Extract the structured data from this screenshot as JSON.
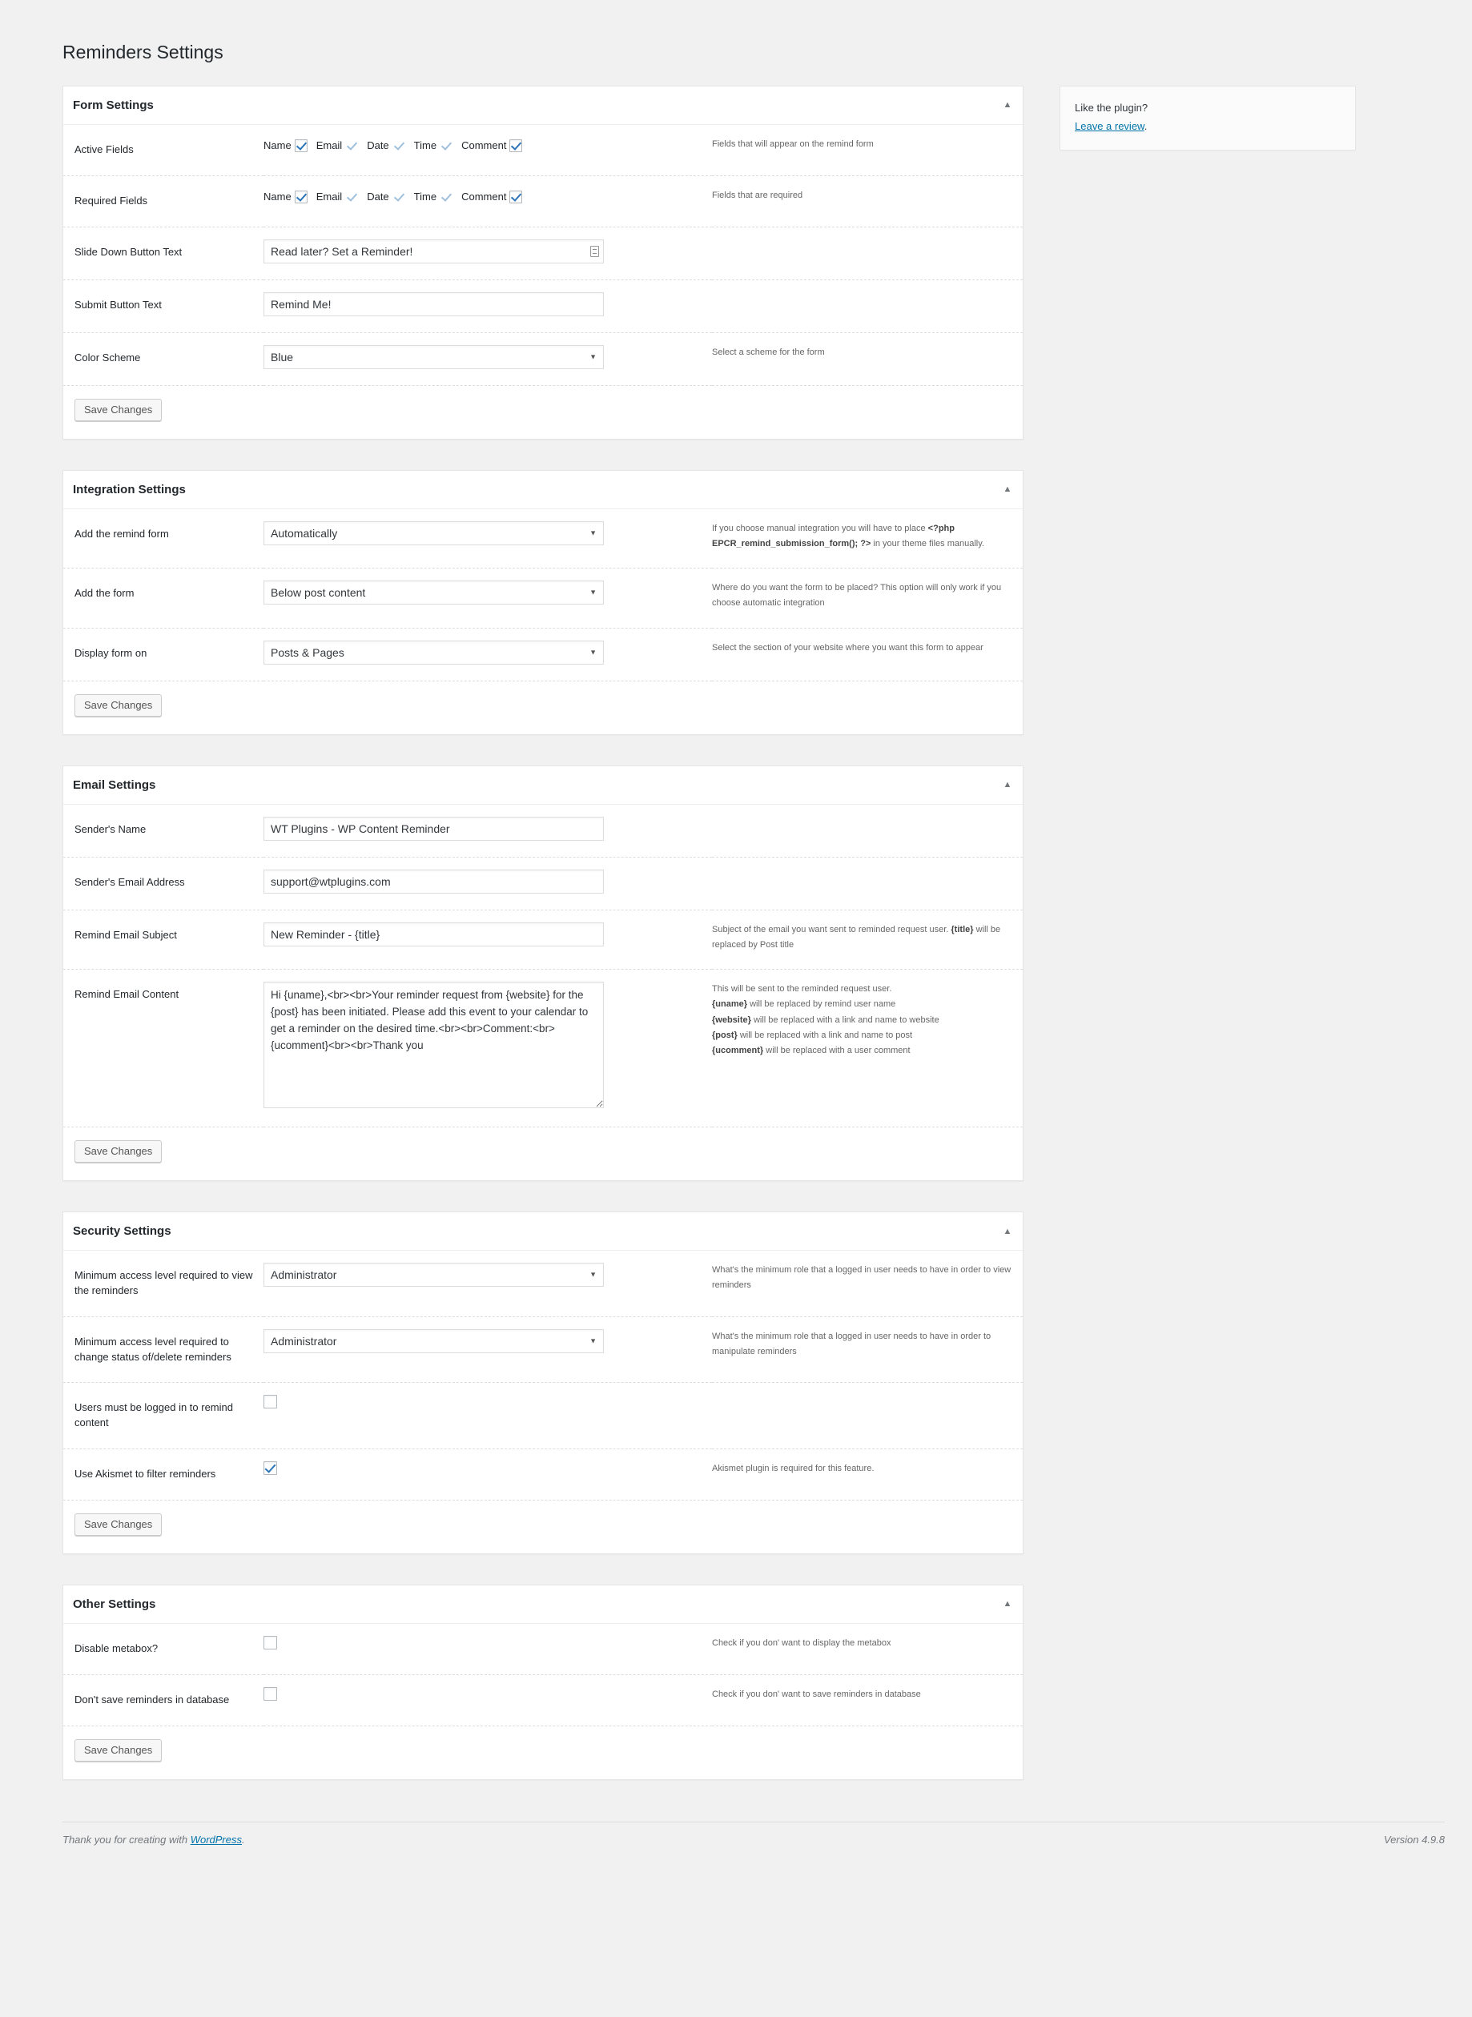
{
  "page": {
    "title": "Reminders Settings"
  },
  "sidebar": {
    "like_text": "Like the plugin?",
    "review_link": "Leave a review",
    "review_suffix": "."
  },
  "checkbox_fields": {
    "name": "Name",
    "email": "Email",
    "date": "Date",
    "time": "Time",
    "comment": "Comment"
  },
  "sections": {
    "form": {
      "title": "Form Settings",
      "toggle_icon": "chevron-up-icon",
      "rows": {
        "active_fields": {
          "label": "Active Fields",
          "desc": "Fields that will appear on the remind form"
        },
        "required_fields": {
          "label": "Required Fields",
          "desc": "Fields that are required"
        },
        "slide_down": {
          "label": "Slide Down Button Text",
          "value": "Read later? Set a Reminder!",
          "desc": ""
        },
        "submit_text": {
          "label": "Submit Button Text",
          "value": "Remind Me!",
          "desc": ""
        },
        "color_scheme": {
          "label": "Color Scheme",
          "value": "Blue",
          "desc": "Select a scheme for the form"
        }
      },
      "save_label": "Save Changes"
    },
    "integration": {
      "title": "Integration Settings",
      "toggle_icon": "chevron-up-icon",
      "rows": {
        "add_remind_form": {
          "label": "Add the remind form",
          "value": "Automatically",
          "desc_pre": "If you choose manual integration you will have to place ",
          "desc_code": "<?php EPCR_remind_submission_form(); ?>",
          "desc_post": " in your theme files manually."
        },
        "add_the_form": {
          "label": "Add the form",
          "value": "Below post content",
          "desc": "Where do you want the form to be placed? This option will only work if you choose automatic integration"
        },
        "display_form_on": {
          "label": "Display form on",
          "value": "Posts & Pages",
          "desc": "Select the section of your website where you want this form to appear"
        }
      },
      "save_label": "Save Changes"
    },
    "email": {
      "title": "Email Settings",
      "toggle_icon": "chevron-up-icon",
      "rows": {
        "sender_name": {
          "label": "Sender's Name",
          "value": "WT Plugins - WP Content Reminder",
          "desc": ""
        },
        "sender_email": {
          "label": "Sender's Email Address",
          "value": "support@wtplugins.com",
          "desc": ""
        },
        "subject": {
          "label": "Remind Email Subject",
          "value": "New Reminder - {title}",
          "desc_pre": "Subject of the email you want sent to reminded request user. ",
          "desc_code": "{title}",
          "desc_post": " will be replaced by Post title"
        },
        "content": {
          "label": "Remind Email Content",
          "value": "Hi {uname},<br><br>Your reminder request from {website} for the {post} has been initiated. Please add this event to your calendar to get a reminder on the desired time.<br><br>Comment:<br>{ucomment}<br><br>Thank you",
          "desc_intro": "This will be sent to the reminded request user.",
          "desc_tokens": [
            {
              "token": "{uname}",
              "text": " will be replaced by remind user name"
            },
            {
              "token": "{website}",
              "text": " will be replaced with a link and name to website"
            },
            {
              "token": "{post}",
              "text": " will be replaced with a link and name to post"
            },
            {
              "token": "{ucomment}",
              "text": " will be replaced with a user comment"
            }
          ]
        }
      },
      "save_label": "Save Changes"
    },
    "security": {
      "title": "Security Settings",
      "toggle_icon": "chevron-up-icon",
      "rows": {
        "view_level": {
          "label": "Minimum access level required to view the reminders",
          "value": "Administrator",
          "desc": "What's the minimum role that a logged in user needs to have in order to view reminders"
        },
        "change_level": {
          "label": "Minimum access level required to change status of/delete reminders",
          "value": "Administrator",
          "desc": "What's the minimum role that a logged in user needs to have in order to manipulate reminders"
        },
        "must_login": {
          "label": "Users must be logged in to remind content",
          "checked": false,
          "desc": ""
        },
        "akismet": {
          "label": "Use Akismet to filter reminders",
          "checked": true,
          "desc": "Akismet plugin is required for this feature."
        }
      },
      "save_label": "Save Changes"
    },
    "other": {
      "title": "Other Settings",
      "toggle_icon": "chevron-up-icon",
      "rows": {
        "disable_metabox": {
          "label": "Disable metabox?",
          "checked": false,
          "desc": "Check if you don' want to display the metabox"
        },
        "no_save_db": {
          "label": "Don't save reminders in database",
          "checked": false,
          "desc": "Check if you don' want to save reminders in database"
        }
      },
      "save_label": "Save Changes"
    }
  },
  "footer": {
    "thanks_pre": "Thank you for creating with ",
    "wordpress_link": "WordPress",
    "thanks_post": ".",
    "version": "Version 4.9.8"
  },
  "options": {
    "color_scheme": [
      "Blue"
    ],
    "add_remind_form": [
      "Automatically"
    ],
    "add_the_form": [
      "Below post content"
    ],
    "display_form_on": [
      "Posts & Pages"
    ],
    "access_level": [
      "Administrator"
    ]
  },
  "colors": {
    "accent_link": "#0073aa",
    "checkbox_check": "#2b74b8",
    "page_bg": "#f1f1f1",
    "panel_bg": "#ffffff",
    "border": "#e5e5e5"
  }
}
